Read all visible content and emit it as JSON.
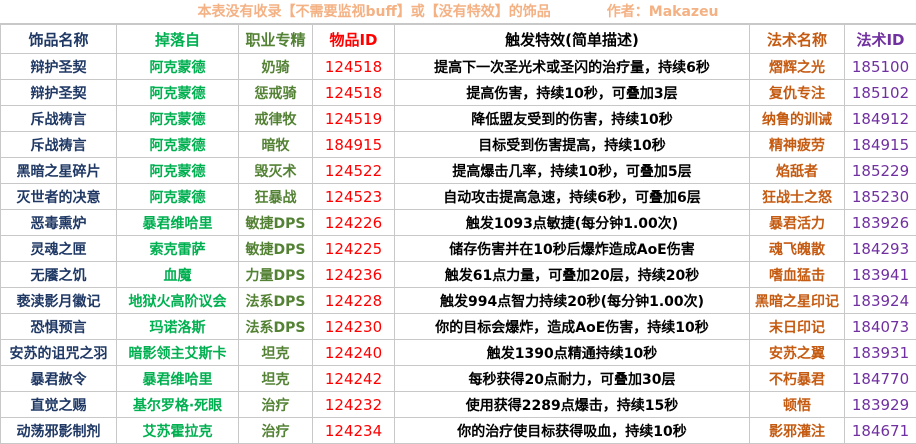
{
  "header_note": {
    "text": "本表没有收录【不需要监视buff】或【没有特效】的饰品",
    "author": "作者：Makazeu"
  },
  "columns": [
    "饰品名称",
    "掉落自",
    "职业专精",
    "物品ID",
    "触发特效(简单描述)",
    "法术名称",
    "法术ID"
  ],
  "rows": [
    [
      "辩护圣契",
      "阿克蒙德",
      "奶骑",
      "124518",
      "提高下一次圣光术或圣闪的治疗量，持续6秒",
      "熠辉之光",
      "185100"
    ],
    [
      "辩护圣契",
      "阿克蒙德",
      "惩戒骑",
      "124518",
      "提高伤害，持续10秒，可叠加3层",
      "复仇专注",
      "185102"
    ],
    [
      "斥战祷言",
      "阿克蒙德",
      "戒律牧",
      "124519",
      "降低盟友受到的伤害，持续10秒",
      "纳鲁的训诫",
      "184912"
    ],
    [
      "斥战祷言",
      "阿克蒙德",
      "暗牧",
      "184915",
      "目标受到伤害提高，持续10秒",
      "精神疲劳",
      "184915"
    ],
    [
      "黑暗之星碎片",
      "阿克蒙德",
      "毁灭术",
      "124522",
      "提高爆击几率，持续10秒，可叠加5层",
      "焰舐者",
      "185229"
    ],
    [
      "灭世者的决意",
      "阿克蒙德",
      "狂暴战",
      "124523",
      "自动攻击提高急速，持续6秒，可叠加6层",
      "狂战士之怒",
      "185230"
    ],
    [
      "恶毒熏炉",
      "暴君维哈里",
      "敏捷DPS",
      "124226",
      "触发1093点敏捷(每分钟1.00次)",
      "暴君活力",
      "183926"
    ],
    [
      "灵魂之匣",
      "索克雷萨",
      "敏捷DPS",
      "124225",
      "储存伤害并在10秒后爆炸造成AoE伤害",
      "魂飞魄散",
      "184293"
    ],
    [
      "无餍之饥",
      "血魔",
      "力量DPS",
      "124236",
      "触发61点力量，可叠加20层，持续20秒",
      "嗜血猛击",
      "183941"
    ],
    [
      "亵渎影月徽记",
      "地狱火高阶议会",
      "法系DPS",
      "124228",
      "触发994点智力持续20秒(每分钟1.00次)",
      "黑暗之星印记",
      "183924"
    ],
    [
      "恐惧预言",
      "玛诺洛斯",
      "法系DPS",
      "124230",
      "你的目标会爆炸，造成AoE伤害，持续10秒",
      "末日印记",
      "184073"
    ],
    [
      "安苏的诅咒之羽",
      "暗影领主艾斯卡",
      "坦克",
      "124240",
      "触发1390点精通持续10秒",
      "安苏之翼",
      "183931"
    ],
    [
      "暴君赦令",
      "暴君维哈里",
      "坦克",
      "124242",
      "每秒获得20点耐力，可叠加30层",
      "不朽暴君",
      "184770"
    ],
    [
      "直觉之赐",
      "基尔罗格·死眼",
      "治疗",
      "124232",
      "使用获得2289点爆击，持续15秒",
      "顿悟",
      "183929"
    ],
    [
      "动荡邪影制剂",
      "艾苏霍拉克",
      "治疗",
      "124234",
      "你的治疗使目标获得吸血，持续10秒",
      "影邪灌注",
      "184671"
    ]
  ]
}
